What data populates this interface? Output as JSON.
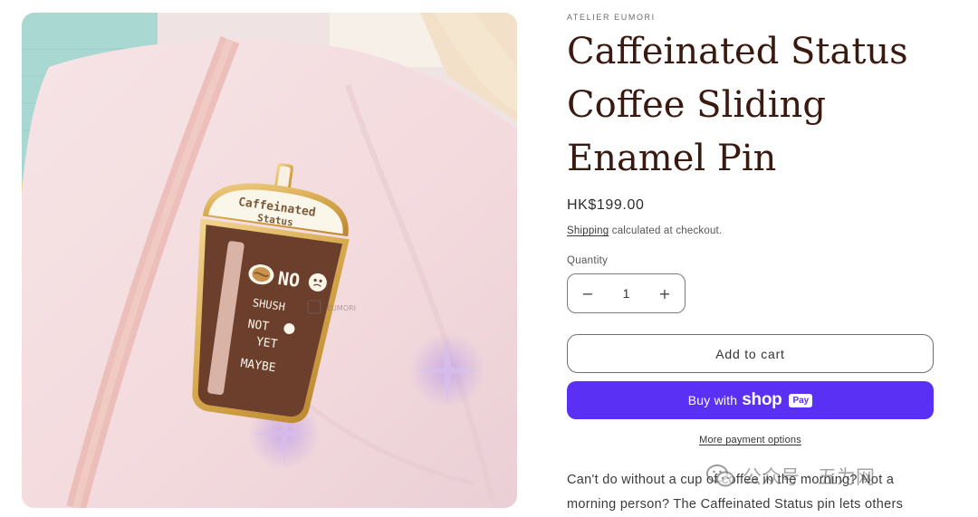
{
  "product": {
    "vendor": "ATELIER EUMORI",
    "title": "Caffeinated Status Coffee Sliding Enamel Pin",
    "price": "HK$199.00",
    "shipping_link": "Shipping",
    "shipping_rest": " calculated at checkout.",
    "quantity_label": "Quantity",
    "quantity": {
      "minus_icon": "minus-icon",
      "value": "1",
      "plus_icon": "plus-icon"
    },
    "add_to_cart": "Add to cart",
    "shop_pay": {
      "buy_with": "Buy with",
      "shop": "shop",
      "pay": "Pay"
    },
    "more_payment_options": "More payment options",
    "description": "Can't do without a cup of coffee in the morning? Not a morning person? The Caffeinated Status pin lets others"
  },
  "image": {
    "pin_title": "Caffeinated Status",
    "pin_options": [
      "NO",
      "SHUSH",
      "NOT YET",
      "MAYBE"
    ],
    "brand_mark": "EUMORI"
  },
  "watermark": {
    "text": "公众号 · 五为网",
    "icon": "wechat-icon"
  }
}
